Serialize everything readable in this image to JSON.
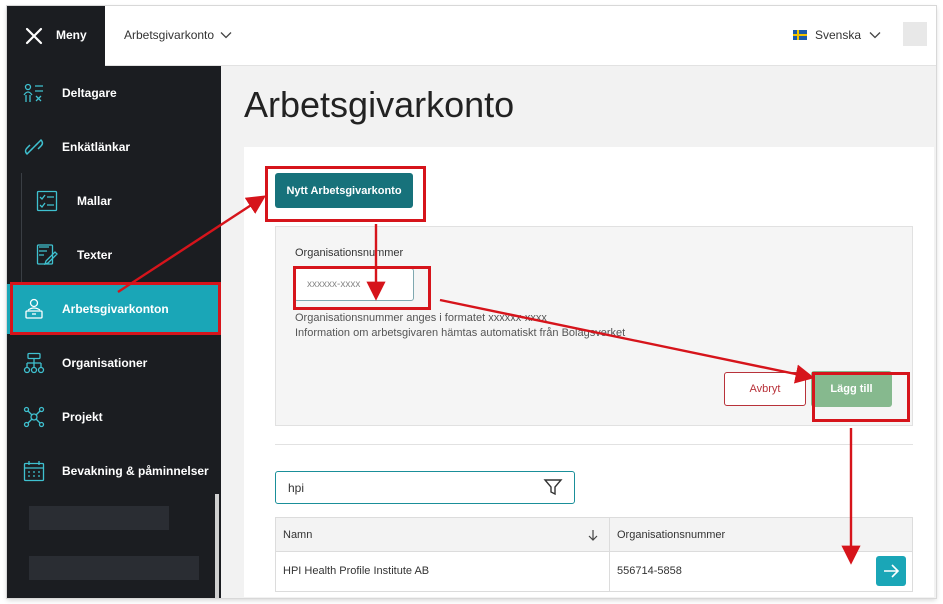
{
  "topbar": {
    "menu_label": "Meny",
    "account_label": "Arbetsgivarkonto",
    "language_label": "Svenska"
  },
  "sidebar": {
    "items": [
      {
        "label": "Deltagare",
        "icon": "participants-icon"
      },
      {
        "label": "Enkätlänkar",
        "icon": "link-icon"
      },
      {
        "label": "Mallar",
        "icon": "template-icon"
      },
      {
        "label": "Texter",
        "icon": "edit-text-icon"
      },
      {
        "label": "Arbetsgivarkonton",
        "icon": "employer-icon"
      },
      {
        "label": "Organisationer",
        "icon": "org-chart-icon"
      },
      {
        "label": "Projekt",
        "icon": "network-icon"
      },
      {
        "label": "Bevakning & påminnelser",
        "icon": "calendar-icon"
      }
    ]
  },
  "main": {
    "title": "Arbetsgivarkonto",
    "new_button": "Nytt Arbetsgivarkonto",
    "form": {
      "label": "Organisationsnummer",
      "placeholder": "xxxxxx-xxxx",
      "help_1": "Organisationsnummer anges i formatet xxxxxx-xxxx",
      "help_2": "Information om arbetsgivaren hämtas automatiskt från Bolagsverket",
      "cancel": "Avbryt",
      "add": "Lägg till"
    },
    "search_value": "hpi",
    "table": {
      "headers": [
        "Namn",
        "Organisationsnummer"
      ],
      "rows": [
        {
          "name": "HPI Health Profile Institute AB",
          "org_number": "556714-5858"
        }
      ]
    }
  },
  "colors": {
    "sidebar_bg": "#1b1d21",
    "active_item": "#1aa6b7",
    "primary_button": "#17727b",
    "add_button": "#86b98e",
    "cancel_border": "#b8323a",
    "annotation_red": "#d6141b"
  }
}
